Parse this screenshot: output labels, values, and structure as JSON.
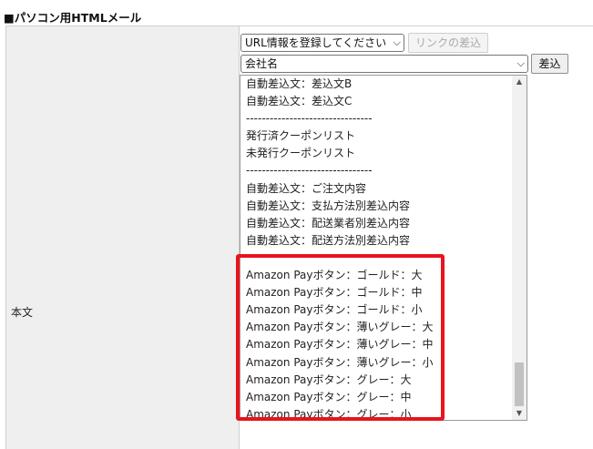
{
  "section_title": "■パソコン用HTMLメール",
  "row_label": "本文",
  "url_select": {
    "value": "URL情報を登録してください"
  },
  "link_insert_button": "リンクの差込",
  "field_select": {
    "value": "会社名"
  },
  "insert_button": "差込",
  "options": [
    "自動差込文：差込文B",
    "自動差込文：差込文C",
    "--------------------------------",
    "発行済クーポンリスト",
    "未発行クーポンリスト",
    "--------------------------------",
    "自動差込文：ご注文内容",
    "自動差込文：支払方法別差込内容",
    "自動差込文：配送業者別差込内容",
    "自動差込文：配送方法別差込内容",
    "",
    "Amazon Payボタン：ゴールド：大",
    "Amazon Payボタン：ゴールド：中",
    "Amazon Payボタン：ゴールド：小",
    "Amazon Payボタン：薄いグレー：大",
    "Amazon Payボタン：薄いグレー：中",
    "Amazon Payボタン：薄いグレー：小",
    "Amazon Payボタン：グレー：大",
    "Amazon Payボタン：グレー：中",
    "Amazon Payボタン：グレー：小"
  ],
  "icons": {
    "select_arrow": "chevron-down-icon",
    "scroll_up": "triangle-up-icon",
    "scroll_down": "triangle-down-icon"
  },
  "colors": {
    "highlight": "#e8141b",
    "label_bg": "#efefef"
  }
}
